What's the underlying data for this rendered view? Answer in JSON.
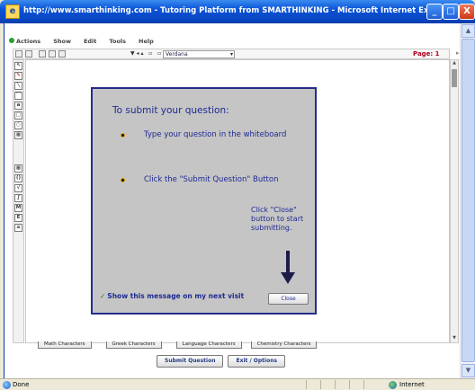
{
  "window": {
    "title": "http://www.smarthinking.com - Tutoring Platform from SMARTHINKING - Microsoft Internet Explorer",
    "minimize": "_",
    "maximize": "□",
    "close": "X"
  },
  "app_menu": [
    "Actions",
    "Show",
    "Edit",
    "Tools",
    "Help"
  ],
  "toolbar": {
    "font": "Verdana",
    "page_label": "Page:",
    "page_number": "1"
  },
  "modal": {
    "title": "To submit your question:",
    "steps": [
      "Type your question in the whiteboard",
      "Click the \"Submit Question\" Button"
    ],
    "hint": "Click \"Close\" button to start submitting.",
    "checkbox_label": "Show this message on my next visit",
    "checkbox_checked": true,
    "close_label": "Close"
  },
  "char_tabs": [
    "Math Characters",
    "Greek Characters",
    "Language Characters",
    "Chemistry Characters"
  ],
  "buttons": {
    "submit": "Submit Question",
    "exit": "Exit / Options"
  },
  "statusbar": {
    "status": "Done",
    "zone": "Internet"
  },
  "colors": {
    "modal_border": "#232c8a",
    "modal_text": "#1e2a92",
    "page_label": "#b00020"
  }
}
